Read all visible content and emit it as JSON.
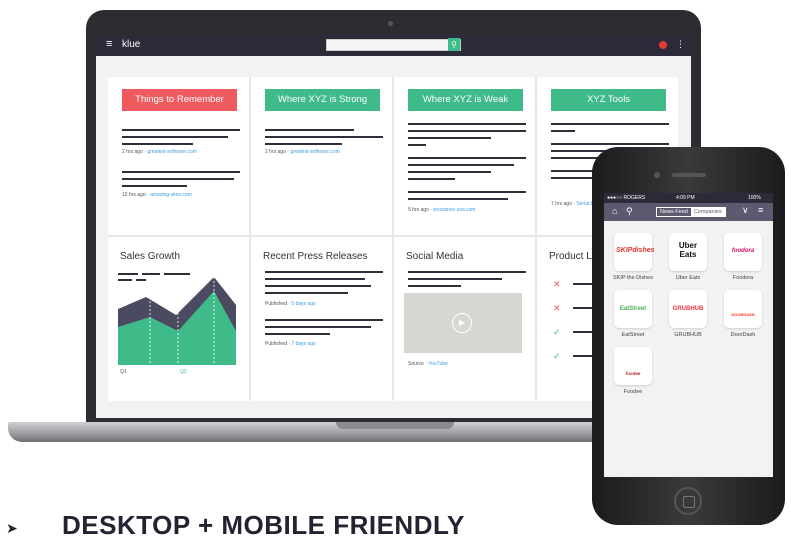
{
  "desktop": {
    "app_logo": "klue",
    "menu_icon": "hamburger-menu-icon",
    "search_placeholder": "",
    "cards": [
      {
        "title": "Things to Remember",
        "style": "red",
        "meta": [
          {
            "time": "2 hrs ago",
            "source": "greatest-software.com"
          },
          {
            "time": "12 hrs ago",
            "source": "amazing-sites.com"
          }
        ]
      },
      {
        "title": "Where XYZ is Strong",
        "style": "green",
        "meta": [
          {
            "time": "2 hrs ago",
            "source": "greatest-software.com"
          }
        ]
      },
      {
        "title": "Where XYZ is Weak",
        "style": "green",
        "meta": [
          {
            "time": "5 hrs ago",
            "source": "insurance-usa.com"
          }
        ]
      },
      {
        "title": "XYZ Tools",
        "style": "green",
        "meta": [
          {
            "time": "7 hrs ago",
            "source": "Serial.8 C"
          }
        ]
      },
      {
        "title": "Sales Growth",
        "chart_labels": [
          "Q1",
          "Q2"
        ]
      },
      {
        "title": "Recent Press Releases",
        "meta": [
          {
            "label": "Published",
            "when": "5 days ago"
          },
          {
            "label": "Published",
            "when": "7 days ago"
          }
        ]
      },
      {
        "title": "Social Media",
        "meta": [
          {
            "label": "Source",
            "when": "YouTube"
          }
        ]
      },
      {
        "title": "Product List"
      }
    ]
  },
  "mobile": {
    "carrier": "●●●○○ ROGERS",
    "time": "4:09 PM",
    "battery": "100%",
    "tabs": [
      "News Feed",
      "Companies"
    ],
    "active_tab": "Companies",
    "companies": [
      {
        "name": "SKIP the Dishes",
        "logo": "SKIPdishes",
        "color": "#e8352b"
      },
      {
        "name": "Uber Eats",
        "logo": "Uber Eats",
        "color": "#111111"
      },
      {
        "name": "Foodora",
        "logo": "foodora",
        "color": "#d70f64"
      },
      {
        "name": "EatStreet",
        "logo": "EatStreet",
        "color": "#4caf50"
      },
      {
        "name": "GRUBHUB",
        "logo": "GRUBHUB",
        "color": "#f63440"
      },
      {
        "name": "DoorDash",
        "logo": "DOORDASH",
        "color": "#ff3008"
      },
      {
        "name": "Foodee",
        "logo": "foodee",
        "color": "#c62828"
      }
    ]
  },
  "caption": "DESKTOP + MOBILE FRIENDLY",
  "colors": {
    "green": "#3fbb89",
    "red": "#ef5a5e",
    "navy": "#2b2b3a"
  }
}
